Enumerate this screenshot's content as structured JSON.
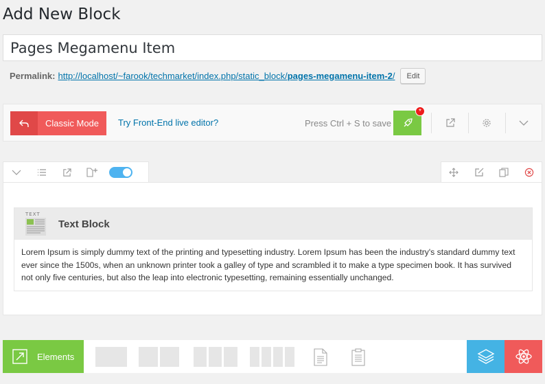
{
  "page": {
    "heading": "Add New Block",
    "title_value": "Pages Megamenu Item"
  },
  "permalink": {
    "label": "Permalink:",
    "url_base": "http://localhost/~farook/techmarket/index.php/static_block/",
    "url_slug": "pages-megamenu-item-2",
    "url_trailing": "/",
    "edit_label": "Edit"
  },
  "toolbar": {
    "classic_mode_label": "Classic Mode",
    "frontend_link_label": "Try Front-End live editor?",
    "save_hint": "Press Ctrl + S to save",
    "publish_badge": "*"
  },
  "element": {
    "thumb_label": "TEXT",
    "title": "Text Block",
    "content": "Lorem Ipsum is simply dummy text of the printing and typesetting industry. Lorem Ipsum has been the industry's standard dummy text ever since the 1500s, when an unknown printer took a galley of type and scrambled it to make a type specimen book. It has survived not only five centuries, but also the leap into electronic typesetting, remaining essentially unchanged."
  },
  "bottom": {
    "elements_label": "Elements"
  },
  "colors": {
    "classic_red": "#f05a5a",
    "publish_green": "#7ac943",
    "link_blue": "#0073aa",
    "layers_blue": "#44b3e4",
    "toggle_blue": "#4eb3f0"
  },
  "icons": [
    "undo-icon",
    "rocket-icon",
    "external-link-icon",
    "gear-icon",
    "chevron-down-icon",
    "list-icon",
    "add-doc-icon",
    "toggle-icon",
    "move-icon",
    "edit-icon",
    "copy-icon",
    "delete-icon",
    "expand-icon",
    "document-icon",
    "clipboard-icon",
    "layers-icon",
    "atom-icon"
  ]
}
